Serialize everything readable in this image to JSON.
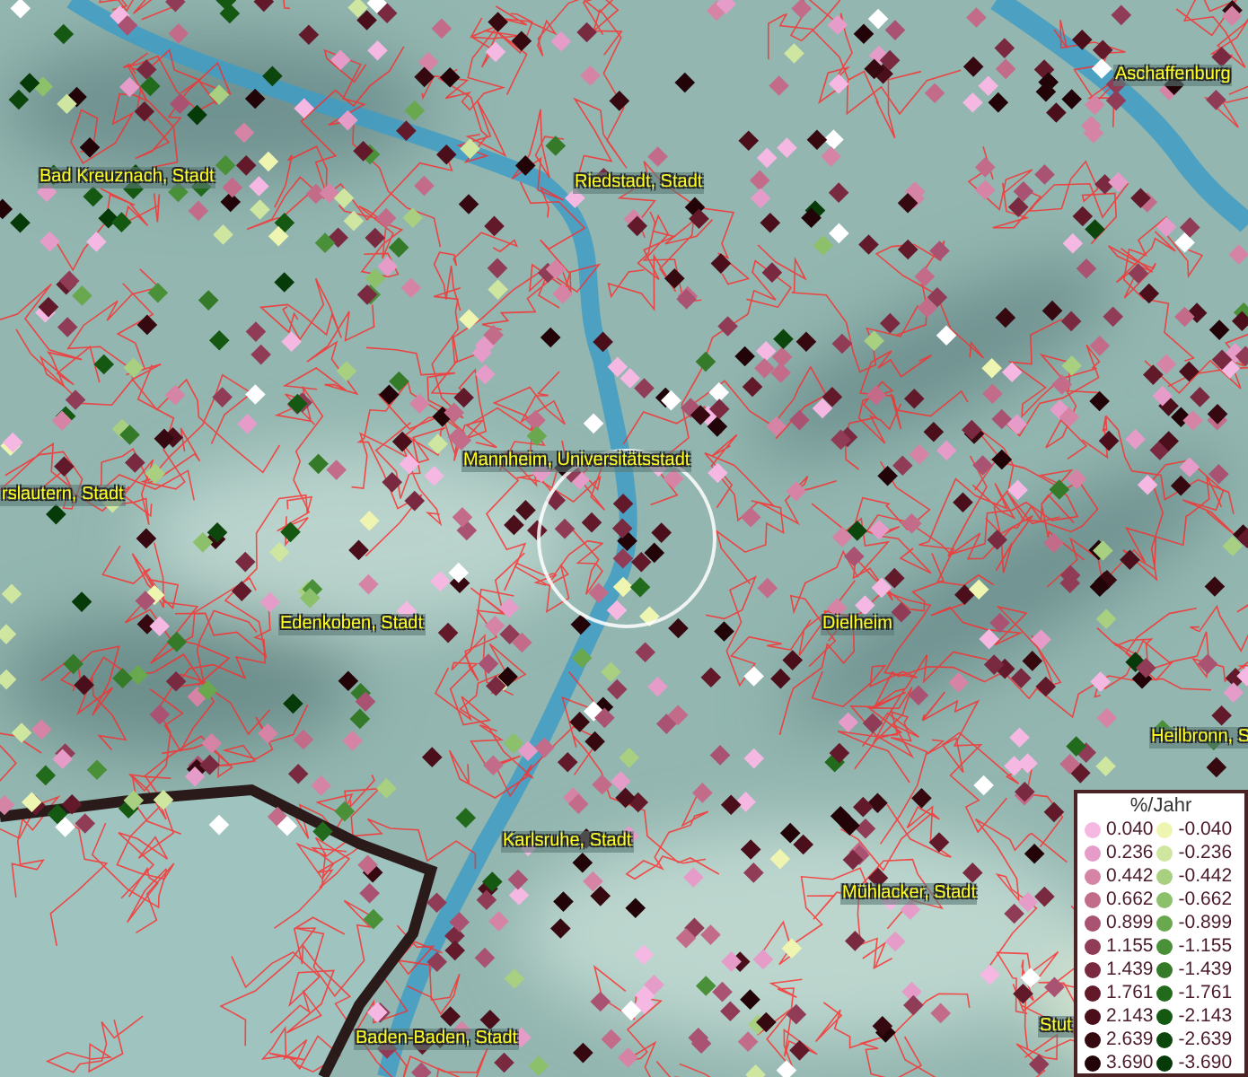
{
  "map": {
    "places": [
      {
        "name": "Aschaffenburg"
      },
      {
        "name": "Bad Kreuznach, Stadt"
      },
      {
        "name": "Riedstadt, Stadt"
      },
      {
        "name": "Mannheim, Universitätsstadt"
      },
      {
        "name": "rslautern, Stadt"
      },
      {
        "name": "Edenkoben, Stadt"
      },
      {
        "name": "Dielheim"
      },
      {
        "name": "Heilbronn, S"
      },
      {
        "name": "Karlsruhe, Stadt"
      },
      {
        "name": "Mühlacker, Stadt"
      },
      {
        "name": "Baden-Baden, Stadt"
      },
      {
        "name": "Stut"
      }
    ]
  },
  "legend": {
    "title": "%/Jahr",
    "columns": [
      {
        "items": [
          {
            "label": "0.040",
            "color": "#f5b8e2"
          },
          {
            "label": "0.236",
            "color": "#e59cc8"
          },
          {
            "label": "0.442",
            "color": "#d684a6"
          },
          {
            "label": "0.662",
            "color": "#c26c8a"
          },
          {
            "label": "0.899",
            "color": "#a95272"
          },
          {
            "label": "1.155",
            "color": "#913c57"
          },
          {
            "label": "1.439",
            "color": "#7a2a40"
          },
          {
            "label": "1.761",
            "color": "#621a2b"
          },
          {
            "label": "2.143",
            "color": "#4a0f1a"
          },
          {
            "label": "2.639",
            "color": "#360810"
          },
          {
            "label": "3.690",
            "color": "#220408"
          }
        ]
      },
      {
        "items": [
          {
            "label": "-0.040",
            "color": "#eef5b0"
          },
          {
            "label": "-0.236",
            "color": "#cfe6a0"
          },
          {
            "label": "-0.442",
            "color": "#a9d080"
          },
          {
            "label": "-0.662",
            "color": "#8cc06a"
          },
          {
            "label": "-0.899",
            "color": "#6aa850"
          },
          {
            "label": "-1.155",
            "color": "#4a9038"
          },
          {
            "label": "-1.439",
            "color": "#347a28"
          },
          {
            "label": "-1.761",
            "color": "#226a1c"
          },
          {
            "label": "-2.143",
            "color": "#145812"
          },
          {
            "label": "-2.639",
            "color": "#0c460c"
          },
          {
            "label": "-3.690",
            "color": "#063a08"
          }
        ]
      }
    ]
  }
}
